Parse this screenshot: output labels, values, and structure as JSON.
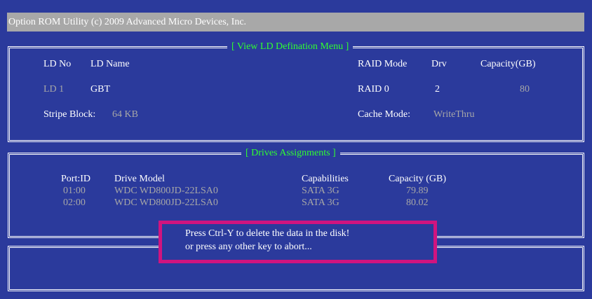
{
  "title_bar": "Option ROM Utility (c) 2009 Advanced Micro Devices, Inc.",
  "ld_panel": {
    "title": "[ View LD Defination Menu ]",
    "headers": {
      "ld_no": "LD No",
      "ld_name": "LD Name",
      "raid_mode": "RAID Mode",
      "drv": "Drv",
      "capacity": "Capacity(GB)"
    },
    "row": {
      "ld_no": "LD 1",
      "ld_name": "GBT",
      "raid_mode": "RAID 0",
      "drv": "2",
      "capacity": "80"
    },
    "stripe_label": "Stripe Block:",
    "stripe_value": "64  KB",
    "cache_label": "Cache Mode:",
    "cache_value": "WriteThru"
  },
  "drives_panel": {
    "title": "[ Drives Assignments ]",
    "headers": {
      "port": "Port:ID",
      "model": "Drive Model",
      "capabilities": "Capabilities",
      "capacity": "Capacity (GB)"
    },
    "rows": [
      {
        "port": "01:00",
        "model": "WDC WD800JD-22LSA0",
        "capabilities": "SATA 3G",
        "capacity": "79.89"
      },
      {
        "port": "02:00",
        "model": "WDC WD800JD-22LSA0",
        "capabilities": "SATA 3G",
        "capacity": "80.02"
      }
    ]
  },
  "dialog": {
    "line1": "Press Ctrl-Y to delete the data in the disk!",
    "line2": "or press any other key to abort..."
  },
  "colors": {
    "background": "#2b3a9c",
    "title_green": "#30ff30",
    "highlight_border": "#d0147f"
  }
}
